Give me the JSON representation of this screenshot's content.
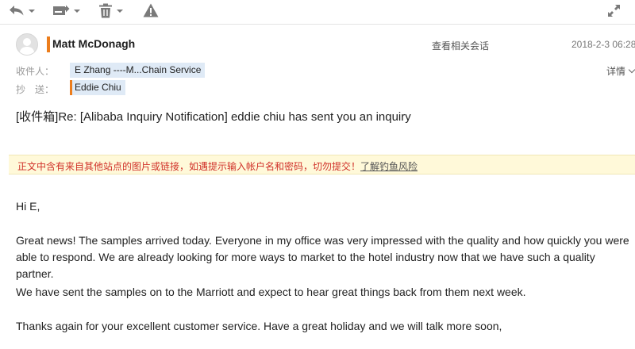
{
  "toolbar": {
    "icons": [
      "reply-icon",
      "forward-icon",
      "delete-icon",
      "report-spam-icon",
      "fullscreen-icon"
    ],
    "icon_color": "#7a7a7a"
  },
  "header": {
    "sender": "Matt McDonagh",
    "related_link": "查看相关会话",
    "datetime": "2018-2-3 06:28",
    "to_label": "收件人：",
    "to_value": "E Zhang ----M...Chain Service",
    "cc_label": "抄　送：",
    "cc_value": "Eddie Chiu",
    "details_label": "详情",
    "accent_color": "#ec7d1c"
  },
  "subject": "[收件箱]Re: [Alibaba Inquiry Notification] eddie chiu has sent you an inquiry",
  "warning": {
    "text": "正文中含有来自其他站点的图片或链接，如遇提示输入帐户名和密码，切勿提交！",
    "link": "了解钓鱼风险",
    "text_color": "#d03028",
    "bg_color": "#fff9d9"
  },
  "body": {
    "greeting": "Hi E,",
    "p1": "Great news!  The samples arrived today.  Everyone in my office was very impressed with the quality and how quickly you were able to respond.  We are already looking for more ways to market to the hotel industry now that we have such a quality partner.",
    "p2": "We have sent the samples on to the Marriott and expect to hear great things back from them next week.",
    "p3": "Thanks again for your excellent customer service.  Have a great holiday and we will talk more soon,"
  }
}
